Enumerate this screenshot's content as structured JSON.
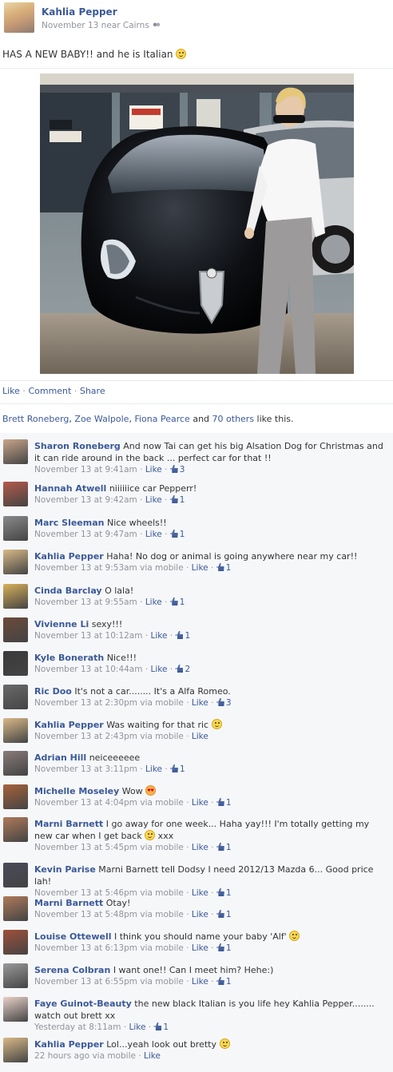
{
  "post": {
    "author": "Kahlia Pepper",
    "timestamp": "November 13 near Cairns",
    "audience_icon": "friends-icon",
    "status_text": "HAS A NEW BABY!! and he is Italian",
    "actions": {
      "like": "Like",
      "dot1": " · ",
      "comment": "Comment",
      "dot2": " · ",
      "share": "Share"
    },
    "likes": {
      "names": [
        "Brett Roneberg",
        "Zoe Walpole",
        "Fiona Pearce"
      ],
      "sep1": ", ",
      "sep2": ", ",
      "and": " and ",
      "others": "70 others",
      "suffix": " like this."
    }
  },
  "comments": [
    {
      "name": "Sharon Roneberg",
      "text": "And now Tai can get his big Alsation Dog for Christmas and it can ride around in the back ... perfect car for that !!",
      "time": "November 13 at 9:41am",
      "via": "",
      "likes": "3",
      "like_label": "Like",
      "avatar_color": "#c9a58a"
    },
    {
      "name": "Hannah Atwell",
      "text": "niiiiiice car Pepperr!",
      "time": "November 13 at 9:42am",
      "via": "",
      "likes": "1",
      "like_label": "Like",
      "avatar_color": "#b55a4a"
    },
    {
      "name": "Marc Sleeman",
      "text": "Nice wheels!!",
      "time": "November 13 at 9:47am",
      "via": "",
      "likes": "1",
      "like_label": "Like",
      "avatar_color": "#8a8a8a"
    },
    {
      "name": "Kahlia Pepper",
      "text": "Haha! No dog or animal is going anywhere near my car!!",
      "time": "November 13 at 9:53am",
      "via": "via mobile",
      "likes": "1",
      "like_label": "Like",
      "avatar_color": "#d9b987"
    },
    {
      "name": "Cinda Barclay",
      "text": "O lala!",
      "time": "November 13 at 9:55am",
      "via": "",
      "likes": "1",
      "like_label": "Like",
      "avatar_color": "#d8b05a"
    },
    {
      "name": "Vivienne Li",
      "text": "sexy!!!",
      "time": "November 13 at 10:12am",
      "via": "",
      "likes": "1",
      "like_label": "Like",
      "avatar_color": "#6b4a3a"
    },
    {
      "name": "Kyle Bonerath",
      "text": "Nice!!!",
      "time": "November 13 at 10:44am",
      "via": "",
      "likes": "2",
      "like_label": "Like",
      "avatar_color": "#3a3a3a"
    },
    {
      "name": "Ric Doo",
      "text": "It's not a car........ It's a Alfa Romeo.",
      "time": "November 13 at 2:30pm",
      "via": "via mobile",
      "likes": "3",
      "like_label": "Like",
      "avatar_color": "#6a6a6a"
    },
    {
      "name": "Kahlia Pepper",
      "text": "Was waiting for that ric",
      "time": "November 13 at 2:43pm",
      "via": "via mobile",
      "likes": "",
      "like_label": "Like",
      "avatar_color": "#d9b987",
      "smiley": true
    },
    {
      "name": "Adrian Hill",
      "text": "neiceeeeee",
      "time": "November 13 at 3:11pm",
      "via": "",
      "likes": "1",
      "like_label": "Like",
      "avatar_color": "#8a7a7a"
    },
    {
      "name": "Michelle Moseley",
      "text": "Wow",
      "time": "November 13 at 4:04pm",
      "via": "via mobile",
      "likes": "1",
      "like_label": "Like",
      "avatar_color": "#a8623a",
      "heart": true
    },
    {
      "name": "Marni Barnett",
      "text": "I go away for one week... Haha yay!!! I'm totally getting my new car when I get back",
      "time": "November 13 at 5:45pm",
      "via": "via mobile",
      "likes": "1",
      "like_label": "Like",
      "avatar_color": "#b07a5a",
      "smiley2": " xxx"
    },
    {
      "name": "Kevin Parise",
      "text": "Marni Barnett tell Dodsy I need 2012/13 Mazda 6... Good price lah!",
      "time": "November 13 at 5:46pm",
      "via": "via mobile",
      "likes": "1",
      "like_label": "Like",
      "avatar_color": "#4a4a5a"
    },
    {
      "name": "Marni Barnett",
      "text": "Otay!",
      "time": "November 13 at 5:48pm",
      "via": "via mobile",
      "likes": "1",
      "like_label": "Like",
      "avatar_color": "#b07a5a"
    },
    {
      "name": "Louise Ottewell",
      "text": "I think you should name your baby 'Alf'",
      "time": "November 13 at 6:13pm",
      "via": "via mobile",
      "likes": "1",
      "like_label": "Like",
      "avatar_color": "#a0503a",
      "smiley": true
    },
    {
      "name": "Serena Colbran",
      "text": "I want one!! Can I meet him? Hehe:)",
      "time": "November 13 at 6:55pm",
      "via": "via mobile",
      "likes": "1",
      "like_label": "Like",
      "avatar_color": "#9a9a9a"
    },
    {
      "name": "Faye Guinot-Beauty",
      "text": "the new black Italian is you life hey Kahlia Pepper........ watch out brett xx",
      "time": "Yesterday at 8:11am",
      "via": "",
      "likes": "1",
      "like_label": "Like",
      "avatar_color": "#e8d0c8"
    },
    {
      "name": "Kahlia Pepper",
      "text": "Lol...yeah look out bretty",
      "time": "22 hours ago",
      "via": "via mobile",
      "likes": "",
      "like_label": "Like",
      "avatar_color": "#d9b987",
      "smiley": true
    }
  ]
}
